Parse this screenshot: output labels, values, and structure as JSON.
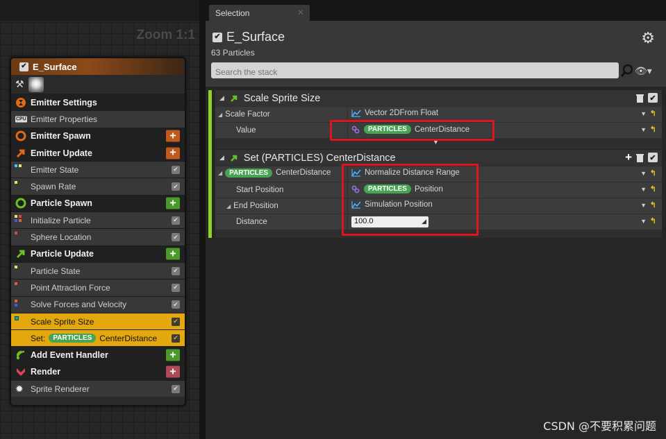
{
  "graph": {
    "zoom_label": "Zoom 1:1",
    "node": {
      "title": "E_Surface",
      "rows": [
        {
          "label": "Emitter Settings",
          "kind": "sec",
          "icon": "emitter-settings-icon",
          "color": "#e36a14"
        },
        {
          "label": "Emitter Properties",
          "kind": "item",
          "icon": "cpu-icon"
        },
        {
          "label": "Emitter Spawn",
          "kind": "sec",
          "icon": "emitter-spawn-icon",
          "color": "#e36a14",
          "add": "#c25a1c"
        },
        {
          "label": "Emitter Update",
          "kind": "sec",
          "icon": "emitter-update-icon",
          "color": "#e36a14",
          "add": "#c25a1c"
        },
        {
          "label": "Emitter State",
          "kind": "item",
          "icon": "module-dots-icon"
        },
        {
          "label": "Spawn Rate",
          "kind": "item",
          "icon": "module-dots-icon"
        },
        {
          "label": "Particle Spawn",
          "kind": "sec",
          "icon": "particle-spawn-icon",
          "color": "#6cc027",
          "add": "#4a9a2a"
        },
        {
          "label": "Initialize Particle",
          "kind": "item",
          "icon": "module-dots-icon"
        },
        {
          "label": "Sphere Location",
          "kind": "item",
          "icon": "module-dots-icon"
        },
        {
          "label": "Particle Update",
          "kind": "sec",
          "icon": "particle-update-icon",
          "color": "#6cc027",
          "add": "#4a9a2a"
        },
        {
          "label": "Particle State",
          "kind": "item",
          "icon": "module-dots-icon"
        },
        {
          "label": "Point Attraction Force",
          "kind": "item",
          "icon": "module-dots-icon"
        },
        {
          "label": "Solve Forces and Velocity",
          "kind": "item",
          "icon": "module-dots-icon"
        },
        {
          "label": "Scale Sprite Size",
          "kind": "hl",
          "icon": "module-dots-icon"
        },
        {
          "label": "Set:",
          "kind": "hl",
          "pill": "PARTICLES",
          "suffix": "CenterDistance"
        },
        {
          "label": "Add Event Handler",
          "kind": "sec",
          "icon": "event-handler-icon",
          "color": "#6cc027",
          "add": "#4a9a2a"
        },
        {
          "label": "Render",
          "kind": "sec",
          "icon": "render-icon",
          "color": "#e0445a",
          "add": "#b0485a"
        },
        {
          "label": "Sprite Renderer",
          "kind": "item",
          "icon": "sprite-renderer-icon"
        }
      ]
    }
  },
  "selection": {
    "tab_label": "Selection",
    "title": "E_Surface",
    "count": "63 Particles",
    "search_placeholder": "Search the stack"
  },
  "modules": {
    "scale": {
      "title": "Scale Sprite Size",
      "scale_factor_label": "Scale Factor",
      "scale_factor_value": "Vector 2DFrom Float",
      "value_label": "Value",
      "value_pill": "PARTICLES",
      "value_name": "CenterDistance"
    },
    "set": {
      "title": "Set (PARTICLES) CenterDistance",
      "row1_pill": "PARTICLES",
      "row1_label": "CenterDistance",
      "row1_value": "Normalize Distance Range",
      "start_label": "Start Position",
      "start_pill": "PARTICLES",
      "start_value": "Position",
      "end_label": "End Position",
      "end_value": "Simulation Position",
      "distance_label": "Distance",
      "distance_value": "100.0"
    }
  },
  "watermark": "CSDN @不要积累问题",
  "colors": {
    "accent_green": "#8fd32a",
    "highlight": "#e3a80e",
    "callout_red": "#e0141e",
    "pill_green": "#48a455"
  }
}
